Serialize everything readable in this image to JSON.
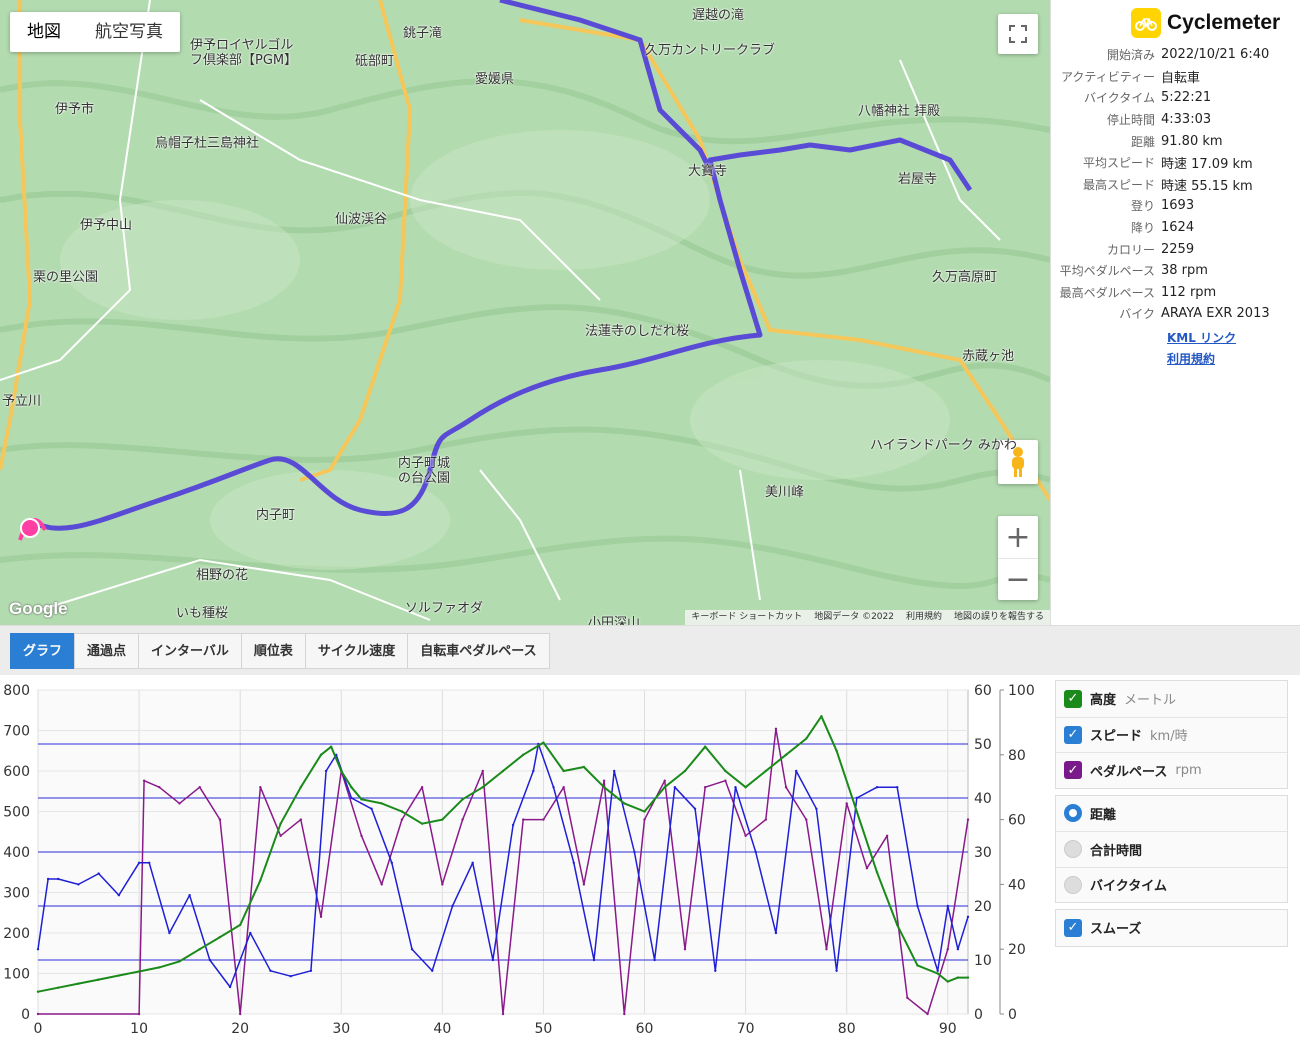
{
  "map": {
    "type_buttons": [
      "地図",
      "航空写真"
    ],
    "fullscreen_icon": "fullscreen-icon",
    "zoom_in": "+",
    "zoom_out": "−",
    "google_logo": "Google",
    "attribution": [
      "キーボード ショートカット",
      "地図データ ©2022",
      "利用規約",
      "地図の誤りを報告する"
    ],
    "places": [
      {
        "label": "遅越の滝"
      },
      {
        "label": "銚子滝"
      },
      {
        "label": "伊予ロイヤルゴルフ倶楽部【PGM】"
      },
      {
        "label": "砥部町"
      },
      {
        "label": "久万カントリークラブ"
      },
      {
        "label": "愛媛県"
      },
      {
        "label": "伊予市"
      },
      {
        "label": "八幡神社 拝殿"
      },
      {
        "label": "烏帽子杜三島神社"
      },
      {
        "label": "岩屋寺"
      },
      {
        "label": "大寶寺"
      },
      {
        "label": "伊予中山"
      },
      {
        "label": "仙波渓谷"
      },
      {
        "label": "栗の里公園"
      },
      {
        "label": "久万高原町"
      },
      {
        "label": "法蓮寺のしだれ桜"
      },
      {
        "label": "赤蔵ヶ池"
      },
      {
        "label": "予立川"
      },
      {
        "label": "ハイランドパーク みかわ"
      },
      {
        "label": "内子町城の台公園"
      },
      {
        "label": "美川峰"
      },
      {
        "label": "内子町"
      },
      {
        "label": "相野の花"
      },
      {
        "label": "いも種桜"
      },
      {
        "label": "ソルファオダ"
      },
      {
        "label": "小田深山"
      }
    ]
  },
  "app": {
    "name": "Cyclemeter",
    "logo_icon": "bicycle-icon"
  },
  "stats": [
    {
      "key": "開始済み",
      "value": "2022/10/21 6:40"
    },
    {
      "key": "アクティビティー",
      "value": "自転車"
    },
    {
      "key": "バイクタイム",
      "value": "5:22:21"
    },
    {
      "key": "停止時間",
      "value": "4:33:03"
    },
    {
      "key": "距離",
      "value": "91.80 km"
    },
    {
      "key": "平均スピード",
      "value": "時速 17.09 km"
    },
    {
      "key": "最高スピード",
      "value": "時速 55.15 km"
    },
    {
      "key": "登り",
      "value": "1693"
    },
    {
      "key": "降り",
      "value": "1624"
    },
    {
      "key": "カロリー",
      "value": "2259"
    },
    {
      "key": "平均ペダルペース",
      "value": "38 rpm"
    },
    {
      "key": "最高ペダルペース",
      "value": "112 rpm"
    },
    {
      "key": "バイク",
      "value": "ARAYA EXR 2013"
    }
  ],
  "links": {
    "kml": "KML リンク",
    "terms": "利用規約"
  },
  "tabs": [
    "グラフ",
    "通過点",
    "インターバル",
    "順位表",
    "サイクル速度",
    "自転車ペダルペース"
  ],
  "legend": {
    "series": [
      {
        "label": "高度",
        "unit": "メートル",
        "color": "#1a8a1a",
        "checked": true
      },
      {
        "label": "スピード",
        "unit": "km/時",
        "color": "#2a7fd4",
        "checked": true
      },
      {
        "label": "ペダルペース",
        "unit": "rpm",
        "color": "#7a1a8a",
        "checked": true
      }
    ],
    "xaxis_options": [
      {
        "label": "距離",
        "selected": true
      },
      {
        "label": "合計時間",
        "selected": false
      },
      {
        "label": "バイクタイム",
        "selected": false
      }
    ],
    "smooth": {
      "label": "スムーズ",
      "checked": true
    }
  },
  "chart_data": {
    "type": "line",
    "xlim": [
      0,
      92
    ],
    "x_ticks": [
      0,
      10,
      20,
      30,
      40,
      50,
      60,
      70,
      80,
      90
    ],
    "y_left": {
      "ticks": [
        0,
        100,
        200,
        300,
        400,
        500,
        600,
        700,
        800
      ],
      "lim": [
        0,
        800
      ]
    },
    "y_right1": {
      "ticks": [
        0,
        10,
        20,
        30,
        40,
        50,
        60
      ],
      "lim": [
        0,
        60
      ]
    },
    "y_right2": {
      "ticks": [
        0,
        20,
        40,
        60,
        80,
        100
      ],
      "lim": [
        0,
        100
      ]
    },
    "series": [
      {
        "name": "高度",
        "axis": "left",
        "color": "#1a8a1a",
        "x": [
          0,
          2,
          4,
          6,
          8,
          10,
          12,
          14,
          16,
          18,
          20,
          22,
          24,
          26,
          28,
          29,
          30,
          31,
          32,
          34,
          36,
          38,
          40,
          42,
          44,
          46,
          48,
          50,
          52,
          54,
          56,
          58,
          60,
          62,
          64,
          66,
          68,
          70,
          72,
          74,
          76,
          77.5,
          79,
          81,
          83,
          85,
          87,
          89,
          90,
          91,
          92
        ],
        "y": [
          55,
          65,
          75,
          85,
          95,
          105,
          115,
          130,
          160,
          190,
          220,
          330,
          470,
          560,
          640,
          660,
          600,
          560,
          530,
          520,
          500,
          470,
          480,
          530,
          560,
          600,
          640,
          670,
          600,
          610,
          560,
          520,
          500,
          560,
          600,
          660,
          600,
          560,
          600,
          640,
          680,
          735,
          650,
          500,
          350,
          220,
          120,
          100,
          80,
          90,
          90
        ]
      },
      {
        "name": "スピード",
        "axis": "right1",
        "color": "#1f1fd6",
        "x": [
          0,
          1,
          2,
          4,
          6,
          8,
          10,
          11,
          13,
          15,
          17,
          19,
          21,
          23,
          25,
          27,
          28.5,
          29.5,
          31,
          33,
          35,
          37,
          39,
          41,
          43,
          45,
          47,
          49,
          49.5,
          51,
          53,
          55,
          57,
          59,
          61,
          63,
          65,
          67,
          69,
          71,
          73,
          75,
          77,
          79,
          81,
          83,
          85,
          87,
          89,
          90,
          91,
          92
        ],
        "y": [
          12,
          25,
          25,
          24,
          26,
          22,
          28,
          28,
          15,
          22,
          10,
          5,
          15,
          8,
          7,
          8,
          45,
          48,
          40,
          38,
          28,
          12,
          8,
          20,
          28,
          10,
          35,
          45,
          50,
          42,
          28,
          10,
          45,
          30,
          10,
          42,
          38,
          8,
          42,
          30,
          15,
          45,
          38,
          8,
          40,
          42,
          42,
          20,
          8,
          20,
          12,
          18
        ]
      },
      {
        "name": "ペダルペース",
        "axis": "right2",
        "color": "#8a1a8a",
        "x": [
          0,
          10,
          10.5,
          12,
          14,
          16,
          18,
          20,
          22,
          24,
          26,
          28,
          30,
          32,
          34,
          36,
          38,
          40,
          42,
          44,
          46,
          48,
          50,
          52,
          54,
          56,
          58,
          60,
          62,
          64,
          66,
          68,
          70,
          72,
          73,
          74,
          76,
          78,
          80,
          82,
          84,
          86,
          88,
          90,
          92
        ],
        "y": [
          0,
          0,
          72,
          70,
          65,
          70,
          60,
          0,
          70,
          55,
          60,
          30,
          75,
          55,
          40,
          60,
          70,
          40,
          60,
          75,
          0,
          60,
          60,
          70,
          40,
          72,
          0,
          60,
          72,
          20,
          70,
          72,
          55,
          60,
          88,
          70,
          60,
          20,
          65,
          45,
          55,
          5,
          0,
          20,
          60
        ]
      }
    ]
  }
}
